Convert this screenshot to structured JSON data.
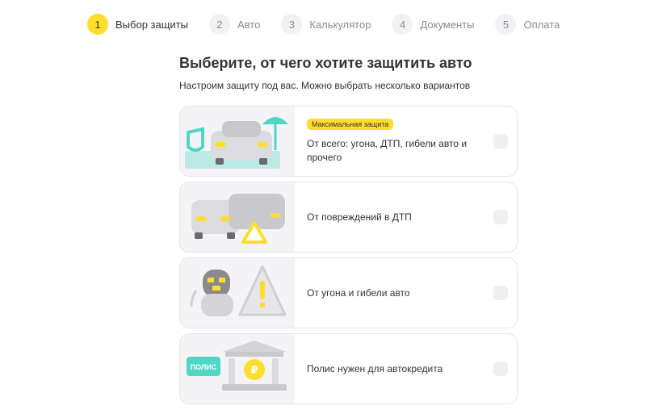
{
  "steps": [
    {
      "num": "1",
      "label": "Выбор защиты"
    },
    {
      "num": "2",
      "label": "Авто"
    },
    {
      "num": "3",
      "label": "Калькулятор"
    },
    {
      "num": "4",
      "label": "Документы"
    },
    {
      "num": "5",
      "label": "Оплата"
    }
  ],
  "active_step": 1,
  "header": {
    "title": "Выберите, от чего хотите защитить авто",
    "subtitle": "Настроим защиту под вас. Можно выбрать несколько вариантов"
  },
  "options": [
    {
      "badge": "Максимальная защита",
      "label": "От всего: угона, ДТП, гибели авто и прочего",
      "checked": false,
      "illustration": "car-shield-umbrella"
    },
    {
      "label": "От повреждений в ДТП",
      "checked": false,
      "illustration": "cars-collision-warning"
    },
    {
      "label": "От угона и гибели авто",
      "checked": false,
      "illustration": "robber-warning"
    },
    {
      "label": "Полис нужен для автокредита",
      "checked": false,
      "illustration": "bank-policy"
    }
  ],
  "colors": {
    "accent": "#ffdd2d",
    "teal": "#4fd6c4",
    "text": "#333333",
    "muted": "#8a8a8f"
  },
  "illustration_text": {
    "policy_sign": "ПОЛИС"
  }
}
